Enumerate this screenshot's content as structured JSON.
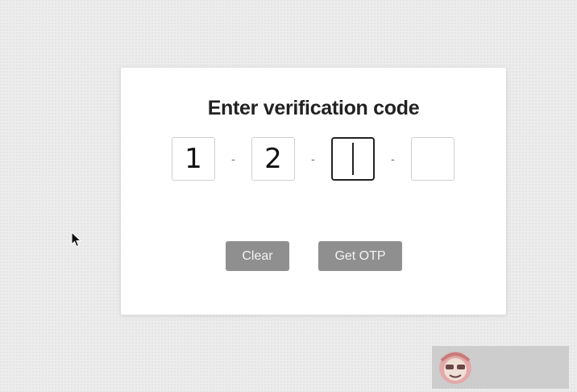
{
  "otp_card": {
    "title": "Enter verification code",
    "digits": [
      {
        "value": "1"
      },
      {
        "value": "2"
      },
      {
        "value": ""
      },
      {
        "value": ""
      }
    ],
    "separator": "-",
    "active_index": 2,
    "buttons": {
      "clear_label": "Clear",
      "get_otp_label": "Get OTP"
    }
  },
  "icons": {
    "cursor": "mouse-pointer-icon",
    "watermark": "watermark-logo-icon"
  },
  "colors": {
    "background": "#ececec",
    "card": "#ffffff",
    "button": "#8f8f8f",
    "active_border": "#222222"
  }
}
